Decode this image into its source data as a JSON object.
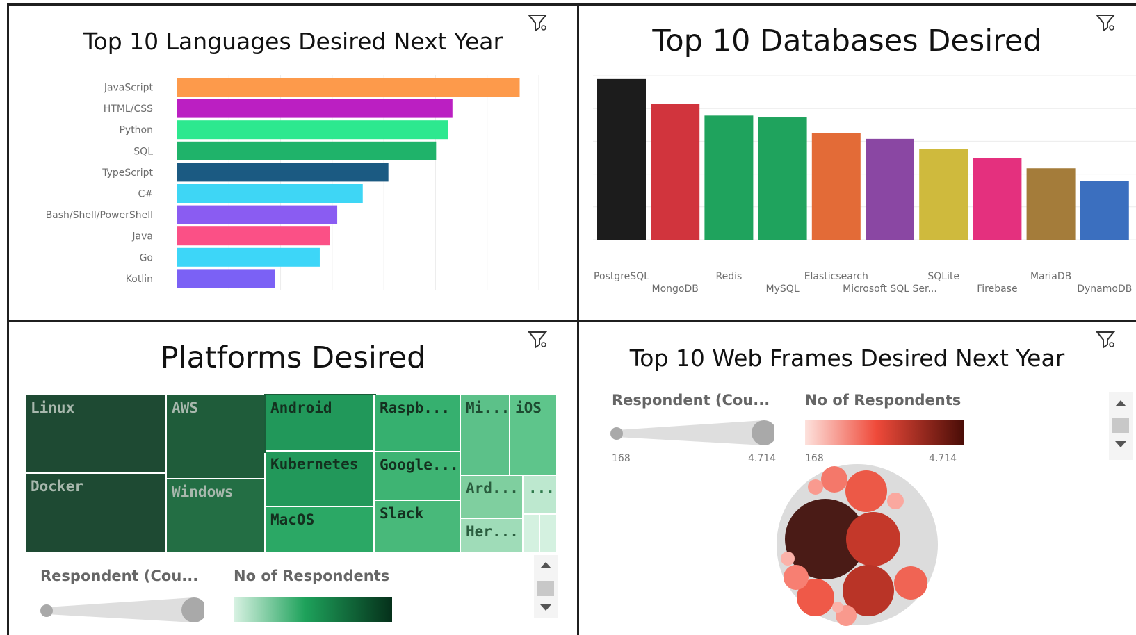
{
  "panels": {
    "languages_title": "Top 10 Languages Desired Next Year",
    "databases_title": "Top 10 Databases Desired",
    "platforms_title": "Platforms Desired",
    "webframes_title": "Top 10 Web Frames Desired Next Year"
  },
  "chart_data": [
    {
      "type": "bar",
      "orientation": "horizontal",
      "title": "Top 10 Languages Desired Next Year",
      "categories": [
        "JavaScript",
        "HTML/CSS",
        "Python",
        "SQL",
        "TypeScript",
        "C#",
        "Bash/Shell/PowerShell",
        "Java",
        "Go",
        "Kotlin"
      ],
      "values": [
        6630,
        5328,
        5239,
        5012,
        4088,
        3591,
        3097,
        2953,
        2759,
        1890
      ],
      "colors": [
        "#fd9a4b",
        "#bb1fc2",
        "#2de88f",
        "#1fb36a",
        "#1b5a82",
        "#3ed6f5",
        "#8a5cf2",
        "#fb5086",
        "#3dd6f8",
        "#7b61f5"
      ],
      "xlim": [
        0,
        7000
      ],
      "grid": true
    },
    {
      "type": "bar",
      "title": "Top 10 Databases Desired",
      "categories": [
        "PostgreSQL",
        "MongoDB",
        "Redis",
        "MySQL",
        "Elasticsearch",
        "Microsoft SQL Ser...",
        "SQLite",
        "Firebase",
        "MariaDB",
        "DynamoDB"
      ],
      "values": [
        4328,
        3649,
        3331,
        3281,
        2856,
        2706,
        2440,
        2193,
        1916,
        1570
      ],
      "colors": [
        "#1c1c1c",
        "#d1343d",
        "#1fa35d",
        "#1fa35d",
        "#e36b37",
        "#8a47a3",
        "#cfba3d",
        "#e4307e",
        "#a47c3a",
        "#3b6fbf"
      ],
      "ylim": [
        0,
        4400
      ],
      "grid": true
    },
    {
      "type": "treemap",
      "title": "Platforms Desired",
      "categories": [
        "Linux",
        "Docker",
        "AWS",
        "Windows",
        "Android",
        "Kubernetes",
        "MacOS",
        "Raspb...",
        "Google...",
        "Slack",
        "Mi...",
        "iOS",
        "Ard...",
        "...",
        "Her..."
      ],
      "colors": [
        "#1e4a33",
        "#1e4a33",
        "#1f5c3a",
        "#236e44",
        "#21985a",
        "#22985a",
        "#2ba865",
        "#36b06f",
        "#3eb473",
        "#48b97a",
        "#5cc189",
        "#5ec58b",
        "#7fcf9f",
        "#bde8cf",
        "#9fdcb8"
      ],
      "legend": {
        "size_label": "Respondent (Cou...",
        "color_label": "No of Respondents"
      }
    },
    {
      "type": "bubble",
      "title": "Top 10 Web Frames Desired Next Year",
      "legend": {
        "size_label": "Respondent (Cou...",
        "color_label": "No of Respondents",
        "min": "168",
        "max": "4,714"
      }
    }
  ],
  "colors": {
    "treemap_grad_start": "#d9f2e3",
    "treemap_grad_end": "#05301a",
    "bubble_grad_start": "#fde2dd",
    "bubble_grad_mid": "#ef4a3a",
    "bubble_grad_end": "#4a0d07"
  },
  "icons": {
    "filter": "filter-icon",
    "scroll_up": "chevron-up-icon",
    "scroll_down": "chevron-down-icon"
  }
}
